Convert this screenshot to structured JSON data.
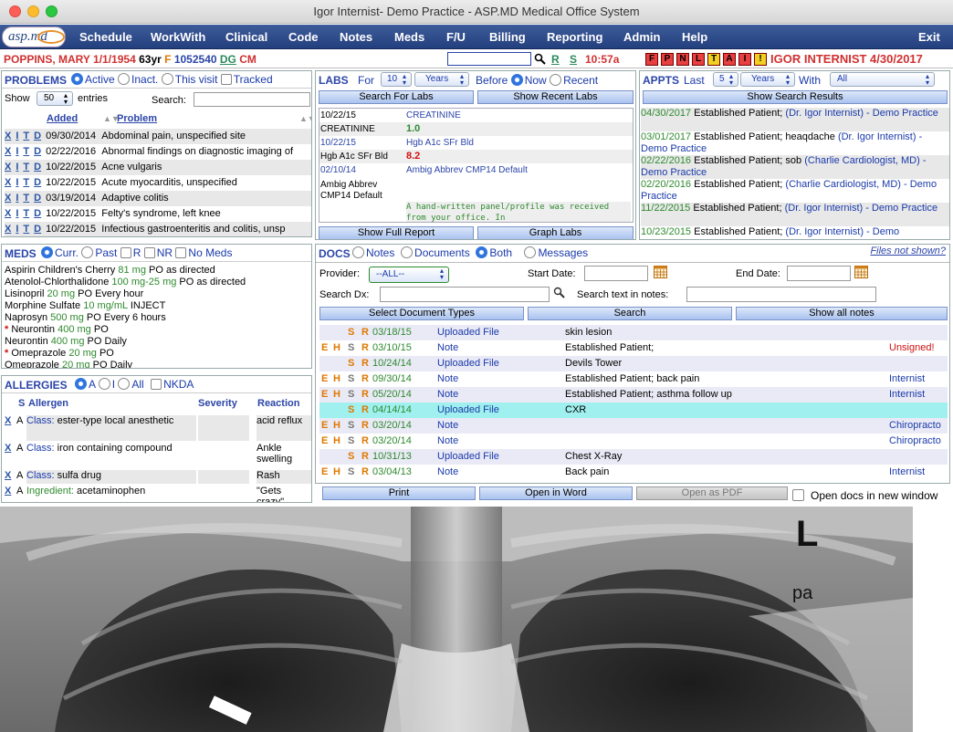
{
  "window": {
    "title": "Igor Internist- Demo Practice - ASP.MD Medical Office System"
  },
  "logo": {
    "text": "asp.md"
  },
  "menu": [
    "Schedule",
    "WorkWith",
    "Clinical",
    "Code",
    "Notes",
    "Meds",
    "F/U",
    "Billing",
    "Reporting",
    "Admin",
    "Help",
    "Exit"
  ],
  "patient": {
    "name": "POPPINS, MARY",
    "dob": "1/1/1954",
    "age": "63yr",
    "sex": "F",
    "id": "1052540",
    "dg": "DG",
    "cm": "CM",
    "r": "R",
    "s": "S",
    "time": "10:57a",
    "flags": [
      "F",
      "P",
      "N",
      "L",
      "T",
      "A",
      "I",
      "!"
    ],
    "provider_date": "IGOR INTERNIST 4/30/2017"
  },
  "problems": {
    "title": "PROBLEMS",
    "opts": [
      "Active",
      "Inact.",
      "This visit",
      "Tracked"
    ],
    "show": "Show",
    "entries_val": "50",
    "entries": "entries",
    "search": "Search:",
    "col_added": "Added",
    "col_problem": "Problem",
    "actions": [
      "X",
      "I",
      "T",
      "D"
    ],
    "rows": [
      {
        "date": "09/30/2014",
        "name": "Abdominal pain, unspecified site"
      },
      {
        "date": "02/22/2016",
        "name": "Abnormal findings on diagnostic imaging of"
      },
      {
        "date": "10/22/2015",
        "name": "Acne vulgaris"
      },
      {
        "date": "10/22/2015",
        "name": "Acute myocarditis, unspecified"
      },
      {
        "date": "03/19/2014",
        "name": "Adaptive colitis"
      },
      {
        "date": "10/22/2015",
        "name": "Felty's syndrome, left knee"
      },
      {
        "date": "10/22/2015",
        "name": "Infectious gastroenteritis and colitis, unsp"
      }
    ]
  },
  "meds": {
    "title": "MEDS",
    "opts": [
      "Curr.",
      "Past",
      "R",
      "NR",
      "No Meds"
    ],
    "rows": [
      {
        "star": "",
        "name": "Aspirin Children's Cherry",
        "dose": "81 mg",
        "sig": "PO as directed"
      },
      {
        "star": "",
        "name": "Atenolol-Chlorthalidone",
        "dose": "100 mg-25 mg",
        "sig": "PO as directed"
      },
      {
        "star": "",
        "name": "Lisinopril",
        "dose": "20 mg",
        "sig": "PO Every hour"
      },
      {
        "star": "",
        "name": "Morphine Sulfate",
        "dose": "10 mg/mL",
        "sig": "INJECT"
      },
      {
        "star": "",
        "name": "Naprosyn",
        "dose": "500 mg",
        "sig": "PO Every 6 hours"
      },
      {
        "star": "*",
        "name": "Neurontin",
        "dose": "400 mg",
        "sig": "PO"
      },
      {
        "star": "",
        "name": "Neurontin",
        "dose": "400 mg",
        "sig": "PO Daily"
      },
      {
        "star": "*",
        "name": "Omeprazole",
        "dose": "20 mg",
        "sig": "PO"
      },
      {
        "star": "",
        "name": "Omeprazole",
        "dose": "20 mg",
        "sig": "PO Daily"
      }
    ]
  },
  "allergies": {
    "title": "ALLERGIES",
    "opts": [
      "A",
      "I",
      "All",
      "NKDA"
    ],
    "col_s": "S",
    "col_allergen": "Allergen",
    "col_severity": "Severity",
    "col_reaction": "Reaction",
    "rows": [
      {
        "x": "X",
        "s": "A",
        "type": "Class:",
        "name": "ester-type local anesthetic",
        "reaction": "acid reflux"
      },
      {
        "x": "X",
        "s": "A",
        "type": "Class:",
        "name": "iron containing compound",
        "reaction": "Ankle swelling"
      },
      {
        "x": "X",
        "s": "A",
        "type": "Class:",
        "name": "sulfa drug",
        "reaction": "Rash"
      },
      {
        "x": "X",
        "s": "A",
        "type": "Ingredient:",
        "name": "acetaminophen",
        "reaction": "\"Gets crazy\""
      }
    ]
  },
  "labs": {
    "title": "LABS",
    "for": "For",
    "n": "10",
    "unit": "Years",
    "before": "Before",
    "now": "Now",
    "recent": "Recent",
    "btn_search": "Search For Labs",
    "btn_recent": "Show Recent Labs",
    "rows": [
      {
        "date": "10/22/15",
        "test": "CREATININE"
      },
      {
        "label": "CREATININE",
        "value": "1.0"
      },
      {
        "date": "10/22/15",
        "test": "Hgb A1c SFr Bld"
      },
      {
        "label": "Hgb A1c SFr Bld",
        "value": "8.2"
      },
      {
        "date": "02/10/14",
        "test": "Ambig Abbrev CMP14 Default"
      },
      {
        "label": "Ambig Abbrev CMP14 Default",
        "note": "A hand-written panel/profile was received from your office. In"
      }
    ],
    "btn_full": "Show Full Report",
    "btn_graph": "Graph Labs"
  },
  "appts": {
    "title": "APPTS",
    "last": "Last",
    "n": "5",
    "unit": "Years",
    "with": "With",
    "who": "All",
    "btn": "Show Search Results",
    "rows": [
      {
        "date": "04/30/2017",
        "type": "Established Patient;",
        "reason": "",
        "prov": "(Dr. Igor Internist) - Demo Practice"
      },
      {
        "date": "03/01/2017",
        "type": "Established Patient;",
        "reason": "heaqdache",
        "prov": "(Dr. Igor Internist) - Demo Practice"
      },
      {
        "date": "02/22/2016",
        "type": "Established Patient;",
        "reason": "sob",
        "prov": "(Charlie Cardiologist, MD) - Demo Practice"
      },
      {
        "date": "02/20/2016",
        "type": "Established Patient;",
        "reason": "",
        "prov": "(Charlie Cardiologist, MD) - Demo Practice"
      },
      {
        "date": "11/22/2015",
        "type": "Established Patient;",
        "reason": "",
        "prov": "(Dr. Igor Internist) - Demo Practice"
      },
      {
        "date": "10/23/2015",
        "type": "Established Patient;",
        "reason": "",
        "prov": "(Dr. Igor Internist) - Demo"
      }
    ]
  },
  "docs": {
    "title": "DOCS",
    "opts": [
      "Notes",
      "Documents",
      "Both",
      "Messages"
    ],
    "files_not_shown": "Files not shown?",
    "provider": "Provider:",
    "provider_val": "--ALL--",
    "start": "Start Date:",
    "end": "End Date:",
    "search_dx": "Search Dx:",
    "search_text": "Search text in notes:",
    "btn_types": "Select Document Types",
    "btn_search": "Search",
    "btn_all": "Show all notes",
    "rows": [
      {
        "e": "",
        "h": "",
        "s": "S",
        "r": "R",
        "date": "03/18/15",
        "kind": "Uploaded File",
        "desc": "skin lesion",
        "right": "",
        "hl": false
      },
      {
        "e": "E",
        "h": "H",
        "s": "S",
        "r": "R",
        "date": "03/10/15",
        "kind": "Note",
        "desc": "Established Patient;",
        "right": "Unsigned!",
        "hl": false
      },
      {
        "e": "",
        "h": "",
        "s": "S",
        "r": "R",
        "date": "10/24/14",
        "kind": "Uploaded File",
        "desc": "Devils Tower",
        "right": "",
        "hl": false
      },
      {
        "e": "E",
        "h": "H",
        "s": "S",
        "r": "R",
        "date": "09/30/14",
        "kind": "Note",
        "desc": "Established Patient; back pain",
        "right": "Internist",
        "hl": false
      },
      {
        "e": "E",
        "h": "H",
        "s": "S",
        "r": "R",
        "date": "05/20/14",
        "kind": "Note",
        "desc": "Established Patient; asthma follow up",
        "right": "Internist",
        "hl": false
      },
      {
        "e": "",
        "h": "",
        "s": "S",
        "r": "R",
        "date": "04/14/14",
        "kind": "Uploaded File",
        "desc": "CXR",
        "right": "",
        "hl": true
      },
      {
        "e": "E",
        "h": "H",
        "s": "S",
        "r": "R",
        "date": "03/20/14",
        "kind": "Note",
        "desc": "",
        "right": "Chiropracto",
        "hl": false
      },
      {
        "e": "E",
        "h": "H",
        "s": "S",
        "r": "R",
        "date": "03/20/14",
        "kind": "Note",
        "desc": "",
        "right": "Chiropracto",
        "hl": false
      },
      {
        "e": "",
        "h": "",
        "s": "S",
        "r": "R",
        "date": "10/31/13",
        "kind": "Uploaded File",
        "desc": "Chest X-Ray",
        "right": "",
        "hl": false
      },
      {
        "e": "E",
        "h": "H",
        "s": "S",
        "r": "R",
        "date": "03/04/13",
        "kind": "Note",
        "desc": "Back pain",
        "right": "Internist",
        "hl": false
      }
    ],
    "btn_print": "Print",
    "btn_word": "Open in Word",
    "btn_pdf": "Open as PDF",
    "new_window": "Open docs in new window"
  },
  "xray": {
    "marker": "L",
    "view": "pa"
  },
  "colors": {
    "menu": "#233f7e",
    "accent": "#2b45a8",
    "alert": "#d03030"
  }
}
